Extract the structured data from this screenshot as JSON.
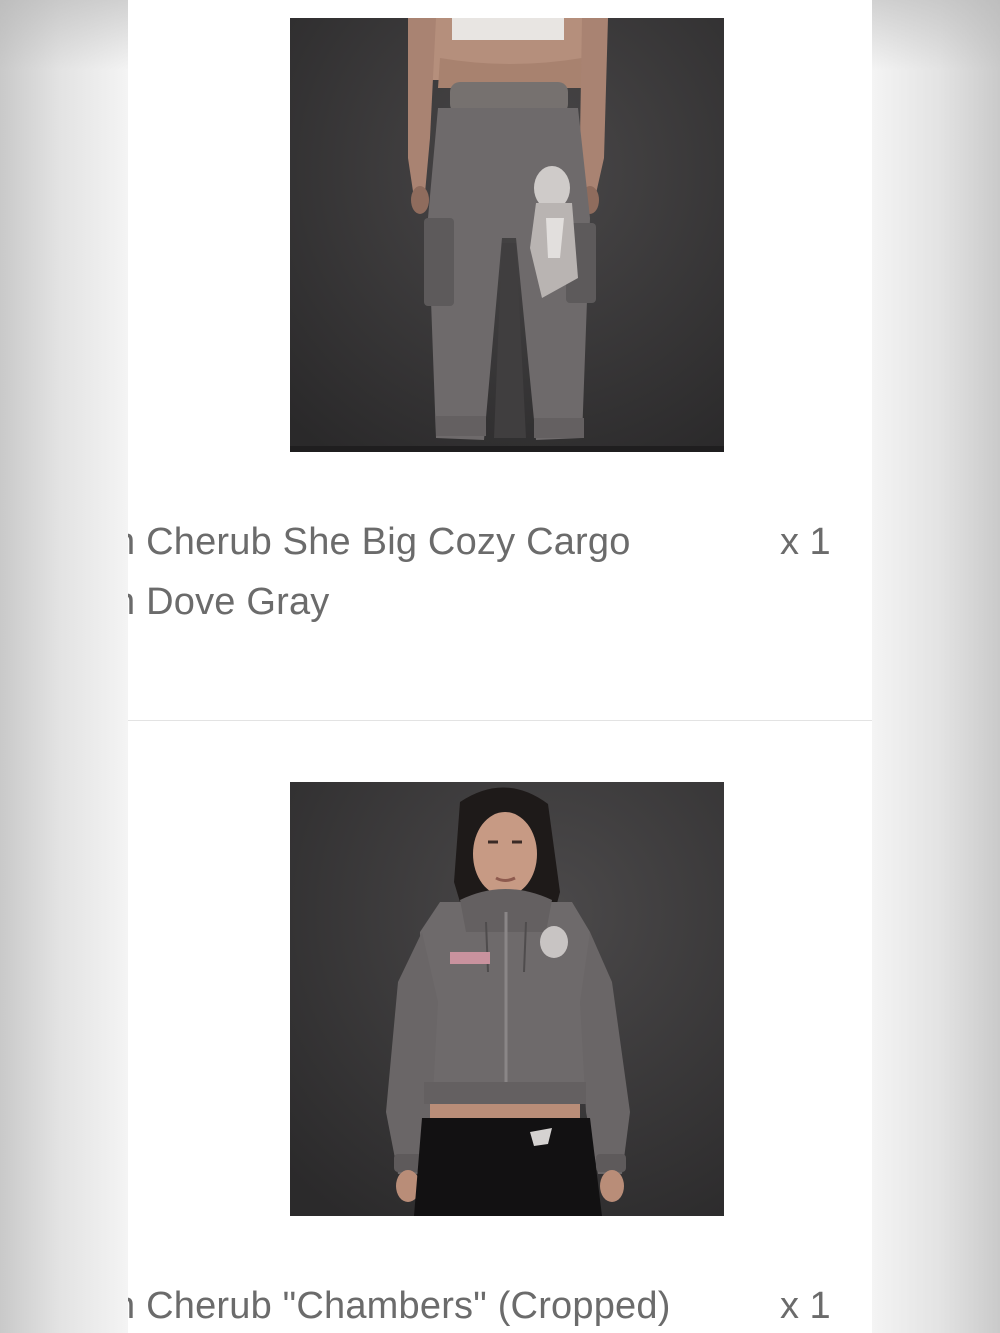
{
  "items": [
    {
      "image_alt": "Cherub She Big Cozy Cargo in Dove Gray",
      "name_line_1": "n Cherub She Big Cozy Cargo",
      "name_line_2": "n Dove Gray",
      "quantity": "x 1"
    },
    {
      "image_alt": "Cherub \"Chambers\" (Cropped)",
      "name_line_1": "n Cherub \"Chambers\" (Cropped)",
      "quantity": "x 1"
    }
  ],
  "colors": {
    "panel": "#ffffff",
    "text": "#6b6b6b",
    "photo_background": "#3c3b3c",
    "garment_gray": "#6e6a6b"
  }
}
